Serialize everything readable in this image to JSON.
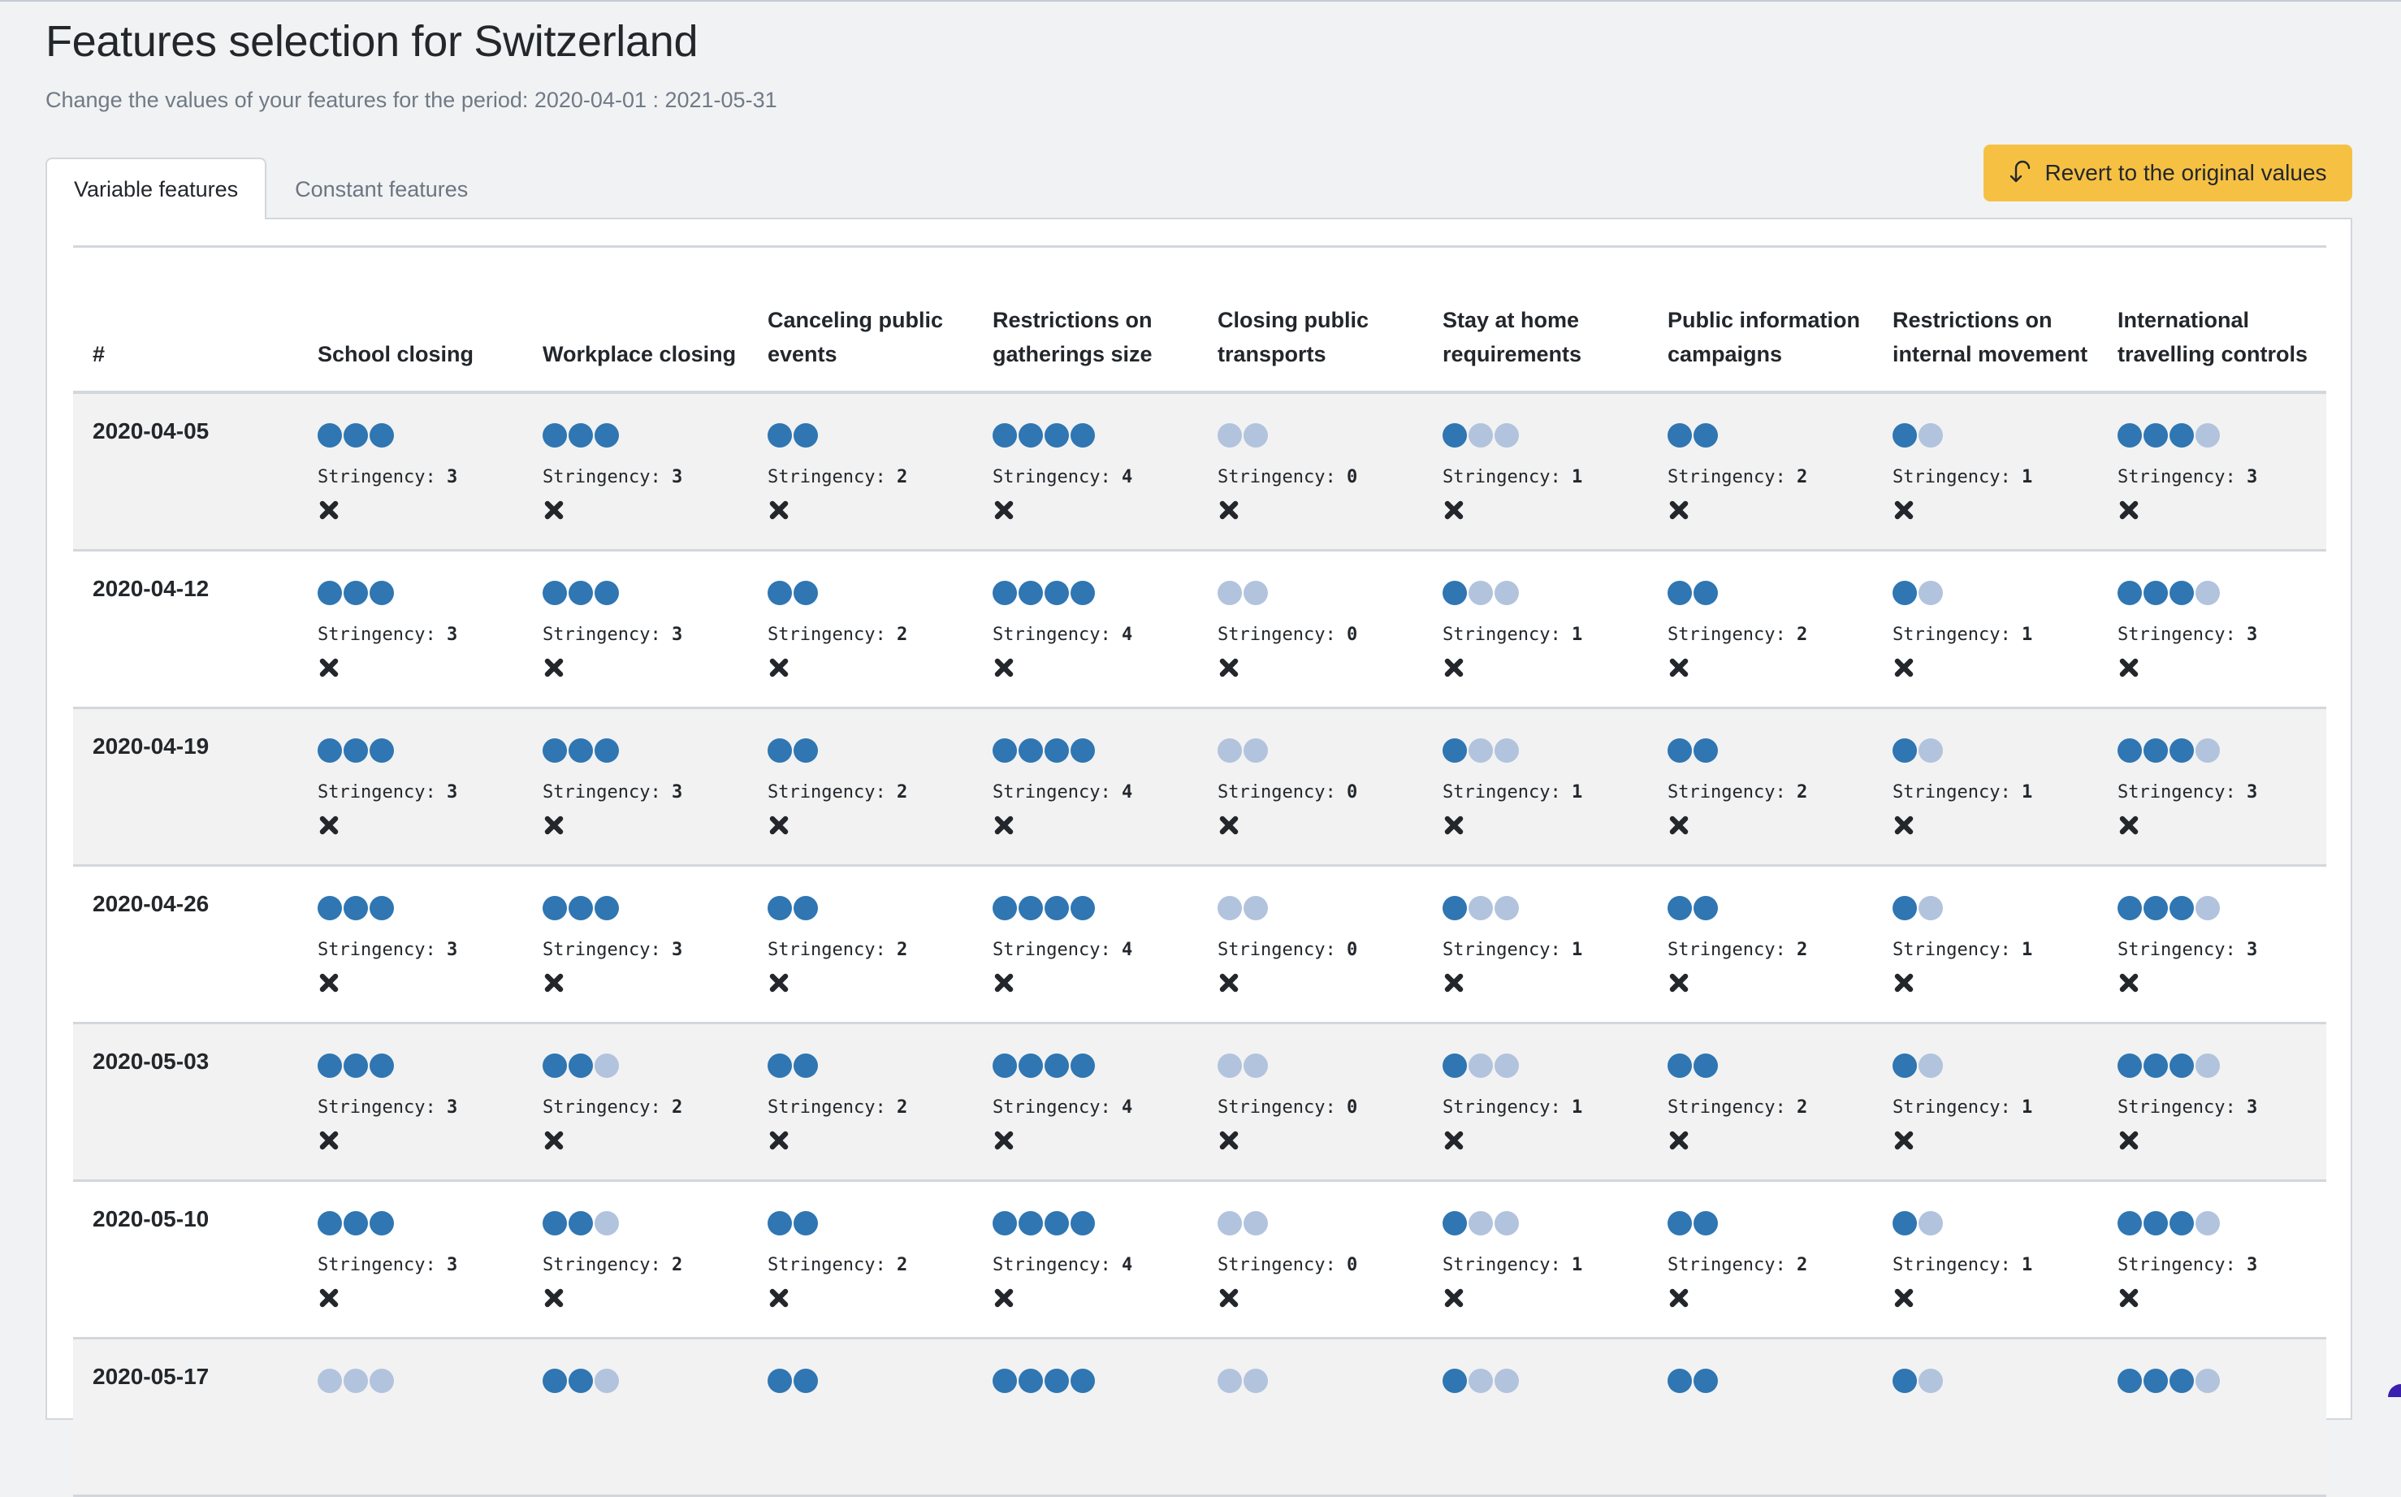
{
  "header": {
    "title": "Features selection for Switzerland",
    "subtitle": "Change the values of your features for the period: 2020-04-01 : 2021-05-31"
  },
  "tabs": [
    {
      "label": "Variable features",
      "active": true
    },
    {
      "label": "Constant features",
      "active": false
    }
  ],
  "revert_button": {
    "label": "Revert to the original values",
    "icon": "undo-arrow-icon"
  },
  "colors": {
    "dot_on": "#2f76b2",
    "dot_off": "#b2c3dd",
    "button": "#f6c143"
  },
  "table": {
    "index_header": "#",
    "stringency_label": "Stringency:",
    "remove_icon": "x-icon",
    "columns": [
      {
        "label": "School closing",
        "levels": 3
      },
      {
        "label": "Workplace closing",
        "levels": 3
      },
      {
        "label": "Canceling public events",
        "levels": 2
      },
      {
        "label": "Restrictions on gatherings size",
        "levels": 4
      },
      {
        "label": "Closing public transports",
        "levels": 2
      },
      {
        "label": "Stay at home requirements",
        "levels": 3
      },
      {
        "label": "Public information campaigns",
        "levels": 2
      },
      {
        "label": "Restrictions on internal movement",
        "levels": 2
      },
      {
        "label": "International travelling controls",
        "levels": 4
      }
    ],
    "rows": [
      {
        "date": "2020-04-05",
        "values": [
          3,
          3,
          2,
          4,
          0,
          1,
          2,
          1,
          3
        ]
      },
      {
        "date": "2020-04-12",
        "values": [
          3,
          3,
          2,
          4,
          0,
          1,
          2,
          1,
          3
        ]
      },
      {
        "date": "2020-04-19",
        "values": [
          3,
          3,
          2,
          4,
          0,
          1,
          2,
          1,
          3
        ]
      },
      {
        "date": "2020-04-26",
        "values": [
          3,
          3,
          2,
          4,
          0,
          1,
          2,
          1,
          3
        ]
      },
      {
        "date": "2020-05-03",
        "values": [
          3,
          2,
          2,
          4,
          0,
          1,
          2,
          1,
          3
        ]
      },
      {
        "date": "2020-05-10",
        "values": [
          3,
          2,
          2,
          4,
          0,
          1,
          2,
          1,
          3
        ]
      },
      {
        "date": "2020-05-17",
        "values": [
          0,
          2,
          2,
          4,
          0,
          1,
          2,
          1,
          3
        ],
        "partial": true
      }
    ]
  }
}
